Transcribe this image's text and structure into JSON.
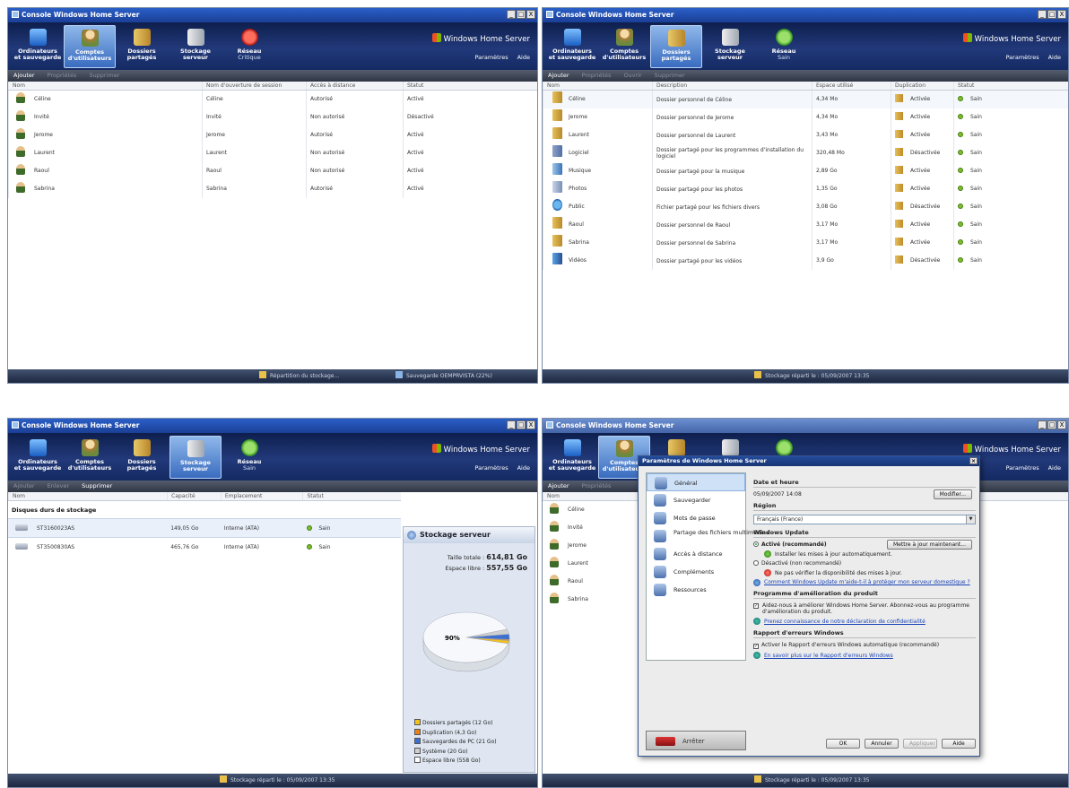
{
  "window_title": "Console Windows Home Server",
  "window_buttons": [
    "_",
    "□",
    "X"
  ],
  "brand": "Windows Home Server",
  "nav_tabs": [
    {
      "label1": "Ordinateurs",
      "label2": "et sauvegarde",
      "icon": "computer-icon"
    },
    {
      "label1": "Comptes",
      "label2": "d'utilisateurs",
      "icon": "users-icon"
    },
    {
      "label1": "Dossiers",
      "label2": "partagés",
      "icon": "shared-folders-icon"
    },
    {
      "label1": "Stockage",
      "label2": "serveur",
      "icon": "server-storage-icon"
    },
    {
      "label1": "Réseau",
      "label2": "Critique",
      "icon": "network-critical-icon"
    }
  ],
  "network_status_ok": "Sain",
  "links": {
    "settings": "Paramètres",
    "help": "Aide"
  },
  "q1": {
    "toolbar": [
      "Ajouter",
      "Propriétés",
      "Supprimer"
    ],
    "columns": [
      "Nom",
      "Nom d'ouverture de session",
      "Accès à distance",
      "Statut"
    ],
    "rows": [
      [
        "Céline",
        "Céline",
        "Autorisé",
        "Activé"
      ],
      [
        "Invité",
        "Invité",
        "Non autorisé",
        "Désactivé"
      ],
      [
        "Jerome",
        "Jerome",
        "Autorisé",
        "Activé"
      ],
      [
        "Laurent",
        "Laurent",
        "Non autorisé",
        "Activé"
      ],
      [
        "Raoul",
        "Raoul",
        "Non autorisé",
        "Activé"
      ],
      [
        "Sabrina",
        "Sabrina",
        "Autorisé",
        "Activé"
      ]
    ],
    "status_storage": "Répartition du stockage...",
    "status_backup": "Sauvegarde OEMPRVISTA (22%)"
  },
  "q2": {
    "toolbar": [
      "Ajouter",
      "Propriétés",
      "Ouvrir",
      "Supprimer"
    ],
    "columns": [
      "Nom",
      "Description",
      "Espace utilisé",
      "Duplication",
      "Statut"
    ],
    "rows": [
      [
        "Céline",
        "Dossier personnel de Céline",
        "4,34 Mo",
        "Activée",
        "Sain"
      ],
      [
        "Jerome",
        "Dossier personnel de Jerome",
        "4,34 Mo",
        "Activée",
        "Sain"
      ],
      [
        "Laurent",
        "Dossier personnel de Laurent",
        "3,43 Mo",
        "Activée",
        "Sain"
      ],
      [
        "Logiciel",
        "Dossier partagé pour les programmes d'installation du logiciel",
        "320,48 Mo",
        "Désactivée",
        "Sain"
      ],
      [
        "Musique",
        "Dossier partagé pour la musique",
        "2,89 Go",
        "Activée",
        "Sain"
      ],
      [
        "Photos",
        "Dossier partagé pour les photos",
        "1,35 Go",
        "Activée",
        "Sain"
      ],
      [
        "Public",
        "Fichier partagé pour les fichiers divers",
        "3,08 Go",
        "Désactivée",
        "Sain"
      ],
      [
        "Raoul",
        "Dossier personnel de Raoul",
        "3,17 Mo",
        "Activée",
        "Sain"
      ],
      [
        "Sabrina",
        "Dossier personnel de Sabrina",
        "3,17 Mo",
        "Activée",
        "Sain"
      ],
      [
        "Vidéos",
        "Dossier partagé pour les vidéos",
        "3,9 Go",
        "Désactivée",
        "Sain"
      ]
    ],
    "status": "Stockage réparti le : 05/09/2007 13:35"
  },
  "q3": {
    "toolbar": [
      "Ajouter",
      "Enlever",
      "Supprimer"
    ],
    "columns": [
      "Nom",
      "Capacité",
      "Emplacement",
      "Statut"
    ],
    "section": "Disques durs de stockage",
    "rows": [
      [
        "ST3160023AS",
        "149,05 Go",
        "Interne (ATA)",
        "Sain"
      ],
      [
        "ST3500830AS",
        "465,76 Go",
        "Interne (ATA)",
        "Sain"
      ]
    ],
    "panel_title": "Stockage serveur",
    "total_label": "Taille totale :",
    "total_value": "614,81 Go",
    "free_label": "Espace libre :",
    "free_value": "557,55 Go",
    "pie_label": "90%",
    "legend": [
      {
        "label": "Dossiers partagés (12 Go)",
        "color": "#f2c21b"
      },
      {
        "label": "Duplication (4,3 Go)",
        "color": "#e7831a"
      },
      {
        "label": "Sauvegardes de PC (21 Go)",
        "color": "#3d6fd0"
      },
      {
        "label": "Système (20 Go)",
        "color": "#cfcfcf"
      },
      {
        "label": "Espace libre (558 Go)",
        "color": "#ffffff"
      }
    ],
    "status": "Stockage réparti le : 05/09/2007 13:35"
  },
  "chart_data": {
    "type": "pie",
    "title": "",
    "series": [
      {
        "name": "Dossiers partagés",
        "value": 12
      },
      {
        "name": "Duplication",
        "value": 4.3
      },
      {
        "name": "Sauvegardes de PC",
        "value": 21
      },
      {
        "name": "Système",
        "value": 20
      },
      {
        "name": "Espace libre",
        "value": 558
      }
    ],
    "units": "Go",
    "slice_label": "90%"
  },
  "q4": {
    "toolbar": [
      "Ajouter",
      "Propriétés"
    ],
    "list_header": "Nom",
    "users": [
      "Céline",
      "Invité",
      "Jerome",
      "Laurent",
      "Raoul",
      "Sabrina"
    ],
    "dialog": {
      "title": "Paramètres de Windows Home Server",
      "nav": [
        "Général",
        "Sauvegarder",
        "Mots de passe",
        "Partage des fichiers multimédias",
        "Accès à distance",
        "Compléments",
        "Ressources"
      ],
      "stop": "Arrêter",
      "date_header": "Date et heure",
      "date_value": "05/09/2007 14:08",
      "modify": "Modifier...",
      "region_header": "Région",
      "region_value": "Français (France)",
      "wu_header": "Windows Update",
      "wu_on": "Activé (recommandé)",
      "wu_update_now": "Mettre à jour maintenant...",
      "wu_on_desc": "Installer les mises à jour automatiquement.",
      "wu_off": "Désactivé (non recommandé)",
      "wu_off_desc": "Ne pas vérifier la disponibilité des mises à jour.",
      "wu_link": "Comment Windows Update m'aide-t-il à protéger mon serveur domestique ?",
      "improve_header": "Programme d'amélioration du produit",
      "improve_chk": "Aidez-nous à améliorer Windows Home Server. Abonnez-vous au programme d'amélioration du produit.",
      "improve_link": "Prenez connaissance de notre déclaration de confidentialité",
      "error_header": "Rapport d'erreurs Windows",
      "error_chk": "Activer le Rapport d'erreurs Windows automatique (recommandé)",
      "error_link": "En savoir plus sur le Rapport d'erreurs Windows",
      "buttons": [
        "OK",
        "Annuler",
        "Appliquer",
        "Aide"
      ]
    },
    "status": "Stockage réparti le : 05/09/2007 13:35"
  }
}
